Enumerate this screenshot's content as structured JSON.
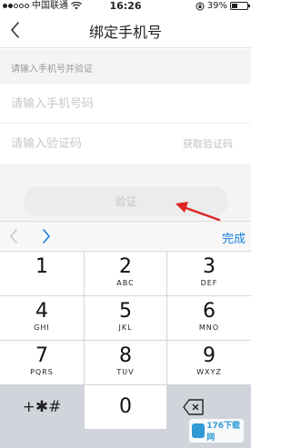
{
  "status": {
    "carrier": "中国联通",
    "time": "16:26",
    "battery_text": "39%",
    "battery_level": 0.39
  },
  "nav": {
    "title": "绑定手机号"
  },
  "form": {
    "hint": "请输入手机号并验证",
    "phone_placeholder": "请输入手机号码",
    "code_placeholder": "请输入验证码",
    "get_code_label": "获取验证码",
    "verify_label": "验证"
  },
  "keyboard": {
    "done_label": "完成",
    "keys": [
      {
        "num": "1",
        "letters": ""
      },
      {
        "num": "2",
        "letters": "ABC"
      },
      {
        "num": "3",
        "letters": "DEF"
      },
      {
        "num": "4",
        "letters": "GHI"
      },
      {
        "num": "5",
        "letters": "JKL"
      },
      {
        "num": "6",
        "letters": "MNO"
      },
      {
        "num": "7",
        "letters": "PQRS"
      },
      {
        "num": "8",
        "letters": "TUV"
      },
      {
        "num": "9",
        "letters": "WXYZ"
      }
    ],
    "symbols_label": "+✱#",
    "zero_label": "0"
  },
  "watermark": {
    "text": "176下载网"
  },
  "colors": {
    "accent": "#1a7fe0",
    "arrow": "#e02424",
    "gray_bg": "#f4f4f6",
    "keypad_bg": "#d1d5db"
  },
  "icons": {
    "back": "chevron-left-icon",
    "prev": "chevron-left-icon",
    "next": "chevron-right-icon",
    "backspace": "backspace-icon",
    "wifi": "wifi-icon",
    "lock": "orientation-lock-icon",
    "battery": "battery-icon"
  }
}
